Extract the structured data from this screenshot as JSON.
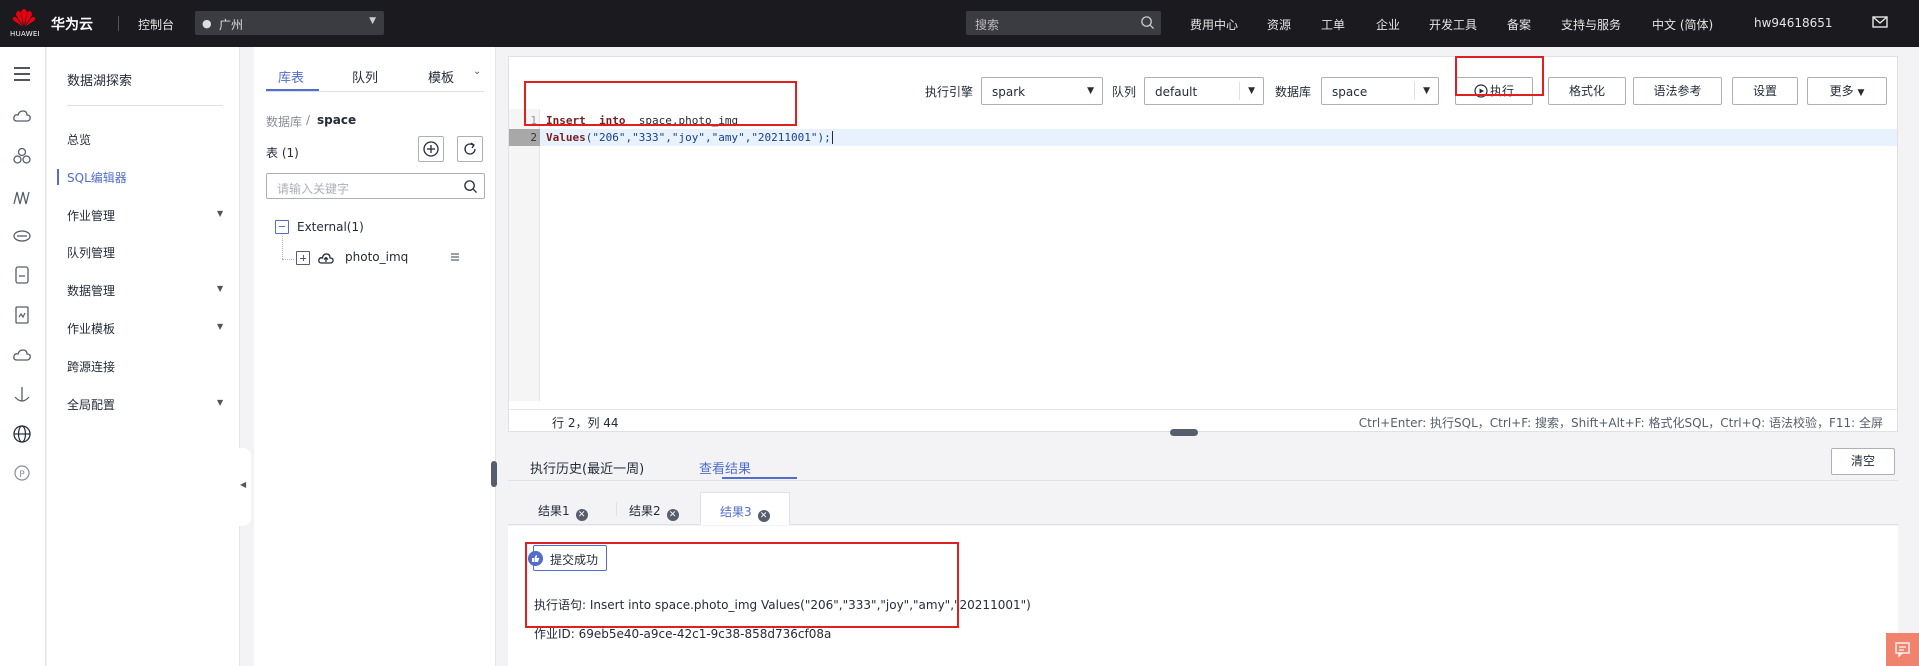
{
  "topbar": {
    "logo_text": "HUAWEI",
    "brand": "华为云",
    "console": "控制台",
    "region": "广州",
    "search_placeholder": "搜索",
    "nav": [
      "费用中心",
      "资源",
      "工单",
      "企业",
      "开发工具",
      "备案",
      "支持与服务",
      "中文 (简体)",
      "hw94618651"
    ]
  },
  "leftnav": {
    "title": "数据湖探索",
    "items": [
      {
        "label": "总览",
        "expandable": false
      },
      {
        "label": "SQL编辑器",
        "expandable": false,
        "active": true
      },
      {
        "label": "作业管理",
        "expandable": true
      },
      {
        "label": "队列管理",
        "expandable": false
      },
      {
        "label": "数据管理",
        "expandable": true
      },
      {
        "label": "作业模板",
        "expandable": true
      },
      {
        "label": "跨源连接",
        "expandable": false
      },
      {
        "label": "全局配置",
        "expandable": true
      }
    ]
  },
  "catalog": {
    "tabs": [
      "库表",
      "队列",
      "模板"
    ],
    "crumb_db": "数据库",
    "crumb_sep": "/",
    "crumb_current": "space",
    "table_count_label": "表 (1)",
    "search_placeholder": "请输入关键字",
    "tree_root": "External(1)",
    "tree_child": "photo_imq"
  },
  "editor": {
    "engine_label": "执行引擎",
    "engine_value": "spark",
    "queue_label": "队列",
    "queue_value": "default",
    "db_label": "数据库",
    "db_value": "space",
    "execute_btn": "执行",
    "format_btn": "格式化",
    "syntax_btn": "语法参考",
    "settings_btn": "设置",
    "more_btn": "更多",
    "line_numbers": [
      "1",
      "2"
    ],
    "code": {
      "l1_kw1": "Insert",
      "l1_kw2": "into",
      "l1_table": "space.photo_img",
      "l2_kw": "Values",
      "l2_args": "(\"206\",\"333\",\"joy\",\"amy\",\"20211001\");"
    },
    "cursor_pos": "行 2，列 44",
    "shortcuts": "Ctrl+Enter: 执行SQL，Ctrl+F: 搜索，Shift+Alt+F: 格式化SQL，Ctrl+Q: 语法校验，F11: 全屏"
  },
  "results": {
    "tabs": [
      "执行历史(最近一周)",
      "查看结果"
    ],
    "clear_btn": "清空",
    "result_tabs": [
      "结果1",
      "结果2",
      "结果3"
    ],
    "success": "提交成功",
    "exec_stmt": "执行语句: Insert into space.photo_img Values(\"206\",\"333\",\"joy\",\"amy\",\"20211001\")",
    "job_id": "作业ID: 69eb5e40-a9ce-42c1-9c38-858d736cf08a"
  },
  "colors": {
    "accent": "#526ecc",
    "highlight_red": "#e02020",
    "topbar": "#1a1a1f"
  }
}
